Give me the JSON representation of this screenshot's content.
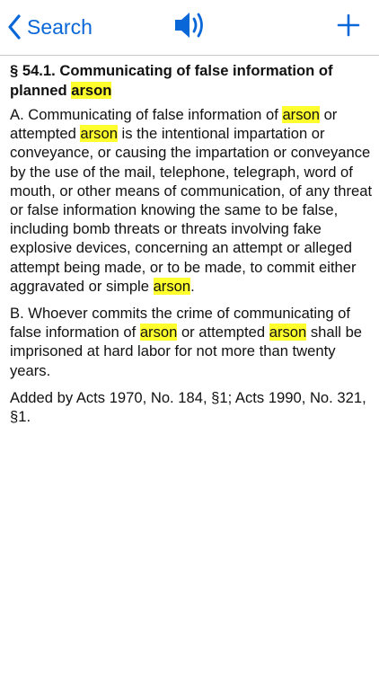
{
  "nav": {
    "back_label": "Search",
    "back_icon": "chevron-left-icon",
    "speaker_icon": "speaker-icon",
    "add_icon": "plus-icon",
    "accent_color": "#0a67d8"
  },
  "highlight": {
    "term": "arson",
    "color": "#ffff2e"
  },
  "document": {
    "title_pre": "§ 54.1. Communicating of false information of planned ",
    "title_hl": "arson",
    "para_a": {
      "t1": "A. Communicating of false information of ",
      "h1": "arson",
      "t2": " or attempted ",
      "h2": "arson",
      "t3": " is the intentional impartation or conveyance, or causing the impartation or conveyance by the use of the mail, telephone, telegraph, word of mouth, or other means of communication, of any threat or false information knowing the same to be false, including bomb threats or threats involving fake explosive devices, concerning an attempt or alleged attempt being made, or to be made, to commit either aggravated or simple ",
      "h3": "arson",
      "t4": "."
    },
    "para_b": {
      "t1": "B. Whoever commits the crime of communicating of false information of ",
      "h1": "arson",
      "t2": " or attempted ",
      "h2": "arson",
      "t3": " shall be imprisoned at hard labor for not more than twenty years."
    },
    "history": "Added by Acts 1970, No. 184, §1; Acts 1990, No. 321, §1."
  }
}
